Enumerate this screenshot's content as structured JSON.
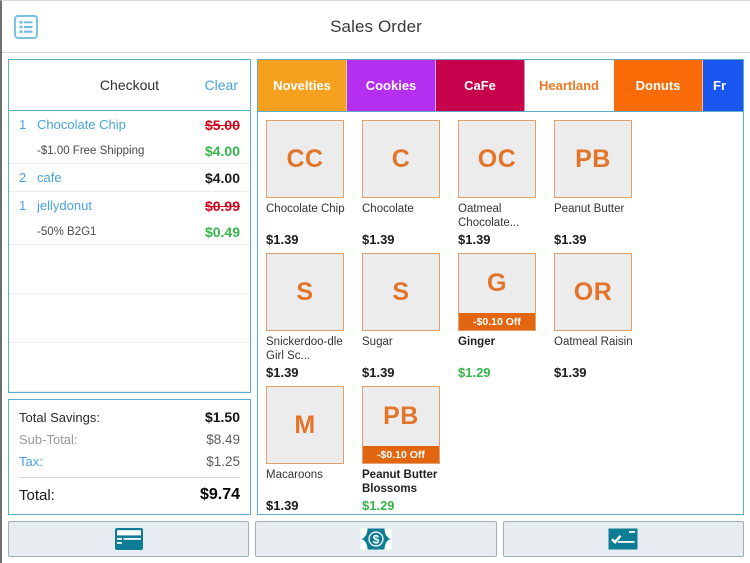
{
  "header": {
    "title": "Sales Order",
    "menu_icon": "list-menu-icon"
  },
  "cart": {
    "title": "Checkout",
    "clear_label": "Clear",
    "items": [
      {
        "qty": "1",
        "name": "Chocolate Chip",
        "price": "$5.00",
        "struck": true,
        "discount_label": "-$1.00 Free Shipping",
        "discount_price": "$4.00"
      },
      {
        "qty": "2",
        "name": "cafe",
        "price": "$4.00",
        "struck": false,
        "discount_label": "",
        "discount_price": ""
      },
      {
        "qty": "1",
        "name": "jellydonut",
        "price": "$0.99",
        "struck": true,
        "discount_label": "-50% B2G1",
        "discount_price": "$0.49"
      }
    ],
    "totals": {
      "savings_label": "Total Savings:",
      "savings_value": "$1.50",
      "subtotal_label": "Sub-Total:",
      "subtotal_value": "$8.49",
      "tax_label": "Tax:",
      "tax_value": "$1.25",
      "total_label": "Total:",
      "total_value": "$9.74"
    }
  },
  "catalog": {
    "tabs": [
      {
        "label": "Novelties",
        "color": "#f5a01e",
        "selected": false,
        "partial": false
      },
      {
        "label": "Cookies",
        "color": "#b52ff0",
        "selected": false,
        "partial": false
      },
      {
        "label": "CaFe",
        "color": "#c7004c",
        "selected": false,
        "partial": false
      },
      {
        "label": "Heartland",
        "color": "#ffffff",
        "selected": true,
        "partial": false
      },
      {
        "label": "Donuts",
        "color": "#f96b07",
        "selected": false,
        "partial": false
      },
      {
        "label": "Fr",
        "color": "#1a56f0",
        "selected": false,
        "partial": true
      }
    ],
    "products": [
      {
        "abbr": "CC",
        "name": "Chocolate Chip",
        "price": "$1.39",
        "badge": "",
        "on_sale": false
      },
      {
        "abbr": "C",
        "name": "Chocolate",
        "price": "$1.39",
        "badge": "",
        "on_sale": false
      },
      {
        "abbr": "OC",
        "name": "Oatmeal Chocolate...",
        "price": "$1.39",
        "badge": "",
        "on_sale": false
      },
      {
        "abbr": "PB",
        "name": "Peanut Butter",
        "price": "$1.39",
        "badge": "",
        "on_sale": false
      },
      {
        "abbr": "S",
        "name": "Snickerdoo-dle Girl Sc...",
        "price": "$1.39",
        "badge": "",
        "on_sale": false
      },
      {
        "abbr": "S",
        "name": "Sugar",
        "price": "$1.39",
        "badge": "",
        "on_sale": false
      },
      {
        "abbr": "G",
        "name": "Ginger",
        "price": "$1.29",
        "badge": "-$0.10 Off",
        "on_sale": true
      },
      {
        "abbr": "OR",
        "name": "Oatmeal Raisin",
        "price": "$1.39",
        "badge": "",
        "on_sale": false
      },
      {
        "abbr": "M",
        "name": "Macaroons",
        "price": "$1.39",
        "badge": "",
        "on_sale": false
      },
      {
        "abbr": "PB",
        "name": "Peanut Butter Blossoms",
        "price": "$1.29",
        "badge": "-$0.10 Off",
        "on_sale": true
      }
    ]
  },
  "payment": {
    "buttons": [
      {
        "icon": "credit-card-icon"
      },
      {
        "icon": "cash-bill-icon"
      },
      {
        "icon": "check-icon"
      }
    ]
  },
  "colors": {
    "accent_blue": "#4aa3df",
    "panel_border": "#5badc9",
    "orange": "#e2752a",
    "sale_green": "#35b54a",
    "strike_red": "#d0021b"
  }
}
